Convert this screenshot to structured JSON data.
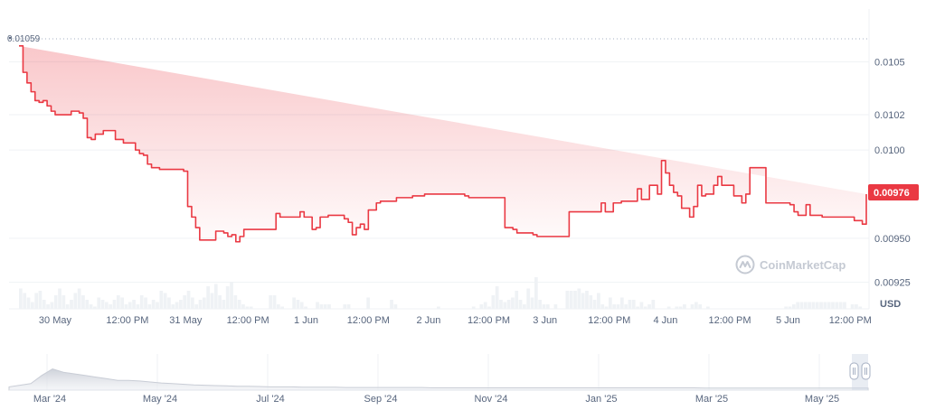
{
  "chart_data": {
    "type": "area",
    "currency": "USD",
    "watermark": "CoinMarketCap",
    "current_price": "0.00976",
    "first_price_label": "0.01059",
    "colors": {
      "line": "#ea3943",
      "badge": "#ea3943",
      "volume": "#eff2f5",
      "grid": "#eff2f5"
    },
    "ylim": [
      0.0091,
      0.01063
    ],
    "yticks": [
      {
        "value": 0.0105,
        "label": "0.0105"
      },
      {
        "value": 0.0102,
        "label": "0.0102"
      },
      {
        "value": 0.01,
        "label": "0.0100"
      },
      {
        "value": 0.00976,
        "label": "0.00976"
      },
      {
        "value": 0.0095,
        "label": "0.00950"
      },
      {
        "value": 0.00925,
        "label": "0.00925"
      }
    ],
    "xlim": [
      0,
      138
    ],
    "xticks": [
      {
        "x": 9,
        "label": "30 May"
      },
      {
        "x": 27,
        "label": "12:00 PM"
      },
      {
        "x": 41.5,
        "label": "31 May"
      },
      {
        "x": 57,
        "label": "12:00 PM"
      },
      {
        "x": 71.5,
        "label": "1 Jun"
      },
      {
        "x": 87,
        "label": "12:00 PM"
      },
      {
        "x": 102,
        "label": "2 Jun"
      },
      {
        "x": 117,
        "label": "12:00 PM"
      },
      {
        "x": 131,
        "label": "3 Jun"
      },
      {
        "x": 147,
        "label": "12:00 PM"
      },
      {
        "x": 161,
        "label": "4 Jun"
      },
      {
        "x": 177,
        "label": "12:00 PM"
      },
      {
        "x": 191.5,
        "label": "5 Jun"
      },
      {
        "x": 207,
        "label": "12:00 PM"
      }
    ],
    "hours": [
      0,
      1,
      2,
      3,
      4,
      5,
      6,
      7,
      8,
      9,
      10,
      11,
      12,
      13,
      14,
      15,
      16,
      17,
      18,
      19,
      20,
      21,
      22,
      23,
      24,
      25,
      26,
      27,
      28,
      29,
      30,
      31,
      32,
      33,
      34,
      35,
      36,
      37,
      38,
      39,
      40,
      41,
      42,
      43,
      44,
      45,
      46,
      47,
      48,
      49,
      50,
      51,
      52,
      53,
      54,
      55,
      56,
      57,
      58,
      59,
      60,
      61,
      62,
      63,
      64,
      65,
      66,
      67,
      68,
      69,
      70,
      71,
      72,
      73,
      74,
      75,
      76,
      77,
      78,
      79,
      80,
      81,
      82,
      83,
      84,
      85,
      86,
      87,
      88,
      89,
      90,
      91,
      92,
      93,
      94,
      95,
      96,
      97,
      98,
      99,
      100,
      101,
      102,
      103,
      104,
      105,
      106,
      107,
      108,
      109,
      110,
      111,
      112,
      113,
      114,
      115,
      116,
      117,
      118,
      119,
      120,
      121,
      122,
      123,
      124,
      125,
      126,
      127,
      128,
      129,
      130,
      131,
      132,
      133,
      134,
      135,
      136,
      137,
      138,
      139,
      140,
      141,
      142,
      143,
      144,
      145,
      146,
      147,
      148,
      149,
      150,
      151,
      152,
      153,
      154,
      155,
      156,
      157,
      158,
      159,
      160,
      161,
      162,
      163,
      164,
      165,
      166,
      167,
      168,
      169,
      170,
      171,
      172,
      173,
      174,
      175,
      176,
      177,
      178,
      179,
      180,
      181,
      182,
      183,
      184,
      185,
      186,
      187,
      188,
      189,
      190,
      191,
      192,
      193,
      194,
      195,
      196,
      197,
      198,
      199,
      200,
      201,
      202,
      203,
      204,
      205,
      206,
      207,
      208,
      209,
      210,
      211
    ],
    "prices": [
      0.01059,
      0.01044,
      0.01038,
      0.01033,
      0.01028,
      0.01027,
      0.01028,
      0.01025,
      0.01022,
      0.0102,
      0.0102,
      0.0102,
      0.0102,
      0.01022,
      0.01022,
      0.01021,
      0.01018,
      0.01007,
      0.01006,
      0.01009,
      0.01009,
      0.01011,
      0.01011,
      0.01011,
      0.01006,
      0.01006,
      0.01004,
      0.01004,
      0.01004,
      0.01,
      0.00998,
      0.00997,
      0.00992,
      0.0099,
      0.0099,
      0.00989,
      0.00989,
      0.00989,
      0.00989,
      0.00989,
      0.00989,
      0.00988,
      0.00968,
      0.00962,
      0.00956,
      0.00949,
      0.00949,
      0.00949,
      0.00949,
      0.00954,
      0.00954,
      0.00953,
      0.00951,
      0.00952,
      0.00948,
      0.00951,
      0.00955,
      0.00955,
      0.00955,
      0.00955,
      0.00955,
      0.00955,
      0.00955,
      0.00955,
      0.00964,
      0.00962,
      0.00962,
      0.00962,
      0.00962,
      0.00962,
      0.00965,
      0.00962,
      0.00962,
      0.00955,
      0.00956,
      0.00962,
      0.00962,
      0.00963,
      0.00963,
      0.00963,
      0.00963,
      0.00961,
      0.00959,
      0.00952,
      0.00956,
      0.00958,
      0.00955,
      0.00966,
      0.00966,
      0.0097,
      0.00971,
      0.00971,
      0.00971,
      0.00971,
      0.00973,
      0.00973,
      0.00973,
      0.00973,
      0.00974,
      0.00974,
      0.00974,
      0.00975,
      0.00975,
      0.00975,
      0.00975,
      0.00975,
      0.00975,
      0.00975,
      0.00975,
      0.00975,
      0.00975,
      0.00974,
      0.00973,
      0.00973,
      0.00973,
      0.00973,
      0.00973,
      0.00973,
      0.00973,
      0.00973,
      0.00973,
      0.00956,
      0.00956,
      0.00955,
      0.00953,
      0.00953,
      0.00953,
      0.00953,
      0.00952,
      0.00951,
      0.00951,
      0.00951,
      0.00951,
      0.00951,
      0.00951,
      0.00951,
      0.00951,
      0.00965,
      0.00965,
      0.00965,
      0.00965,
      0.00965,
      0.00965,
      0.00965,
      0.00965,
      0.0097,
      0.00965,
      0.00965,
      0.0097,
      0.0097,
      0.00971,
      0.00971,
      0.00971,
      0.00971,
      0.00978,
      0.00972,
      0.00972,
      0.0098,
      0.0098,
      0.00975,
      0.00994,
      0.00987,
      0.0098,
      0.00976,
      0.00974,
      0.00967,
      0.00967,
      0.00962,
      0.00968,
      0.0098,
      0.00974,
      0.00975,
      0.00975,
      0.0098,
      0.00985,
      0.0098,
      0.0098,
      0.0098,
      0.00974,
      0.00974,
      0.0097,
      0.00975,
      0.0099,
      0.0099,
      0.0099,
      0.0099,
      0.0097,
      0.0097,
      0.0097,
      0.0097,
      0.0097,
      0.0097,
      0.00969,
      0.00965,
      0.00963,
      0.00963,
      0.00969,
      0.00963,
      0.00963,
      0.00963,
      0.00962,
      0.00962,
      0.00962,
      0.00962,
      0.00962,
      0.00962,
      0.00962,
      0.00962,
      0.0096,
      0.0096,
      0.00958,
      0.00975,
      0.00975,
      0.00976
    ],
    "volumes": [
      0.45,
      0.35,
      0.25,
      0.15,
      0.35,
      0.4,
      0.2,
      0.1,
      0.15,
      0.3,
      0.45,
      0.3,
      0.1,
      0.2,
      0.35,
      0.45,
      0.3,
      0.2,
      0.1,
      0.05,
      0.25,
      0.2,
      0.15,
      0.1,
      0.2,
      0.3,
      0.25,
      0.1,
      0.15,
      0.2,
      0.1,
      0.3,
      0.25,
      0.1,
      0.2,
      0.15,
      0.4,
      0.35,
      0.25,
      0.1,
      0.15,
      0.2,
      0.3,
      0.4,
      0.25,
      0.1,
      0.2,
      0.25,
      0.5,
      0.35,
      0.55,
      0.3,
      0.2,
      0.5,
      0.6,
      0.3,
      0.2,
      0.1,
      0.05,
      0.05,
      0.0,
      0.0,
      0.0,
      0.0,
      0.3,
      0.3,
      0.1,
      0.05,
      0.0,
      0.0,
      0.25,
      0.2,
      0.15,
      0.05,
      0.0,
      0.0,
      0.15,
      0.1,
      0.1,
      0.1,
      0.0,
      0.0,
      0.0,
      0.1,
      0.1,
      0.0,
      0.0,
      0.0,
      0.0,
      0.25,
      0.0,
      0.0,
      0.0,
      0.0,
      0.0,
      0.2,
      0.1,
      0.0,
      0.0,
      0.0,
      0.0,
      0.0,
      0.0,
      0.0,
      0.0,
      0.0,
      0.0,
      0.05,
      0.0,
      0.0,
      0.0,
      0.0,
      0.0,
      0.0,
      0.0,
      0.0,
      0.05,
      0.0,
      0.1,
      0.15,
      0.05,
      0.3,
      0.5,
      0.2,
      0.15,
      0.2,
      0.25,
      0.4,
      0.2,
      0.1,
      0.45,
      0.25,
      0.7,
      0.2,
      0.1,
      0.1,
      0.0,
      0.1,
      0.0,
      0.0,
      0.4,
      0.4,
      0.4,
      0.45,
      0.35,
      0.4,
      0.3,
      0.2,
      0.35,
      0.1,
      0.05,
      0.25,
      0.1,
      0.1,
      0.25,
      0.1,
      0.2,
      0.2,
      0.05,
      0.15,
      0.05,
      0.1,
      0.2,
      0.0,
      0.0,
      0.0,
      0.05,
      0.0,
      0.05,
      0.05,
      0.1,
      0.0,
      0.1,
      0.15,
      0.1,
      0.0,
      0.05,
      0.0,
      0.0,
      0.0,
      0.0,
      0.0,
      0.0,
      0.0,
      0.0,
      0.0,
      0.0,
      0.0,
      0.0,
      0.0,
      0.0,
      0.0,
      0.0,
      0.0,
      0.0,
      0.0,
      0.05,
      0.05,
      0.1,
      0.15,
      0.15,
      0.15,
      0.15,
      0.15,
      0.15,
      0.15,
      0.15,
      0.15,
      0.15,
      0.15,
      0.15,
      0.15,
      0.0,
      0.1,
      0.1,
      0.05,
      0.0
    ],
    "navigator": {
      "ticks": [
        "Mar '24",
        "May '24",
        "Jul '24",
        "Sep '24",
        "Nov '24",
        "Jan '25",
        "Mar '25",
        "May '25"
      ],
      "profile": [
        0.1,
        0.15,
        0.2,
        0.45,
        0.65,
        0.55,
        0.5,
        0.45,
        0.4,
        0.35,
        0.3,
        0.3,
        0.28,
        0.25,
        0.22,
        0.2,
        0.18,
        0.16,
        0.15,
        0.14,
        0.13,
        0.12,
        0.12,
        0.11,
        0.1,
        0.1,
        0.1,
        0.09,
        0.09,
        0.09,
        0.09,
        0.08,
        0.08,
        0.08,
        0.08,
        0.08,
        0.08,
        0.08,
        0.08,
        0.07,
        0.07,
        0.07,
        0.07,
        0.07,
        0.07,
        0.07,
        0.07,
        0.07,
        0.07,
        0.07,
        0.07,
        0.07,
        0.07,
        0.07,
        0.07,
        0.07,
        0.07,
        0.07,
        0.07,
        0.07,
        0.07,
        0.07,
        0.07,
        0.07,
        0.06,
        0.06,
        0.06,
        0.06,
        0.06,
        0.06,
        0.06,
        0.06,
        0.06,
        0.06,
        0.06,
        0.06,
        0.06,
        0.06,
        0.06,
        0.06
      ]
    }
  }
}
